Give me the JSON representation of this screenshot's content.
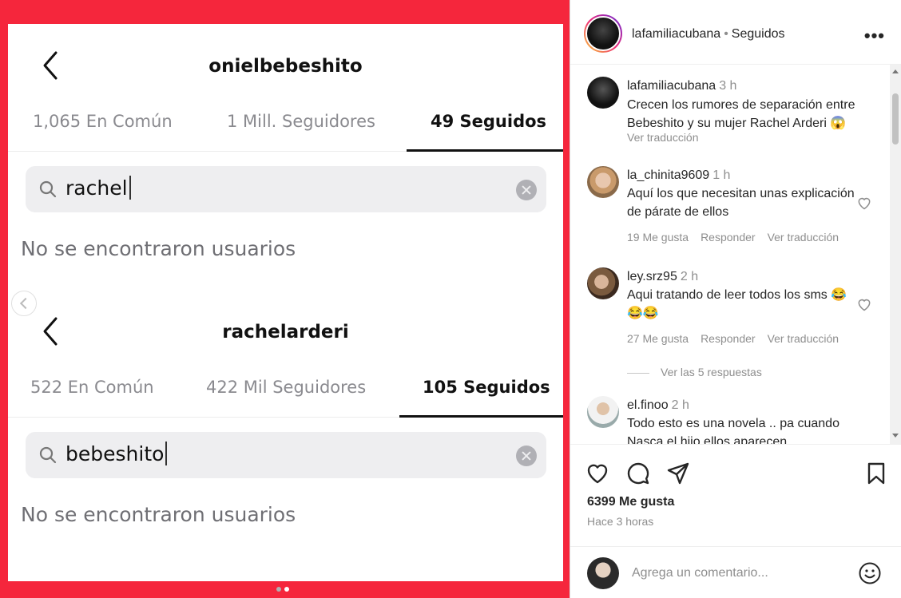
{
  "post": {
    "panels": [
      {
        "username": "onielbebeshito",
        "stats": [
          "1,065 En Común",
          "1 Mill. Seguidores",
          "49 Seguidos"
        ],
        "search_value": "rachel",
        "empty_text": "No se encontraron usuarios"
      },
      {
        "username": "rachelarderi",
        "stats": [
          "522 En Común",
          "422 Mil Seguidores",
          "105 Seguidos"
        ],
        "search_value": "bebeshito",
        "empty_text": "No se encontraron usuarios"
      }
    ]
  },
  "header": {
    "account": "lafamiliacubana",
    "separator": "•",
    "follow_status": "Seguidos",
    "more_label": "•••"
  },
  "comments": [
    {
      "user": "lafamiliacubana",
      "time": "3 h",
      "text": "Crecen los rumores de separación entre Bebeshito y su mujer Rachel Arderi 😱",
      "translate": "Ver traducción"
    },
    {
      "user": "la_chinita9609",
      "time": "1 h",
      "text": "Aquí los que necesitan unas explicación de párate de ellos",
      "likes": "19 Me gusta",
      "reply": "Responder",
      "translate": "Ver traducción"
    },
    {
      "user": "ley.srz95",
      "time": "2 h",
      "text": "Aqui tratando de leer todos los sms 😂😂😂",
      "likes": "27 Me gusta",
      "reply": "Responder",
      "translate": "Ver traducción",
      "replies": "Ver las 5 respuestas"
    },
    {
      "user": "el.finoo",
      "time": "2 h",
      "text": "Todo esto es una novela .. pa cuando Nasca el hijo ellos aparecen"
    }
  ],
  "footer": {
    "likes": "6399 Me gusta",
    "ago": "Hace 3 horas",
    "comment_placeholder": "Agrega un comentario..."
  },
  "colors": {
    "frame": "#f5263c",
    "muted": "#8e8e8e",
    "text": "#262626"
  }
}
